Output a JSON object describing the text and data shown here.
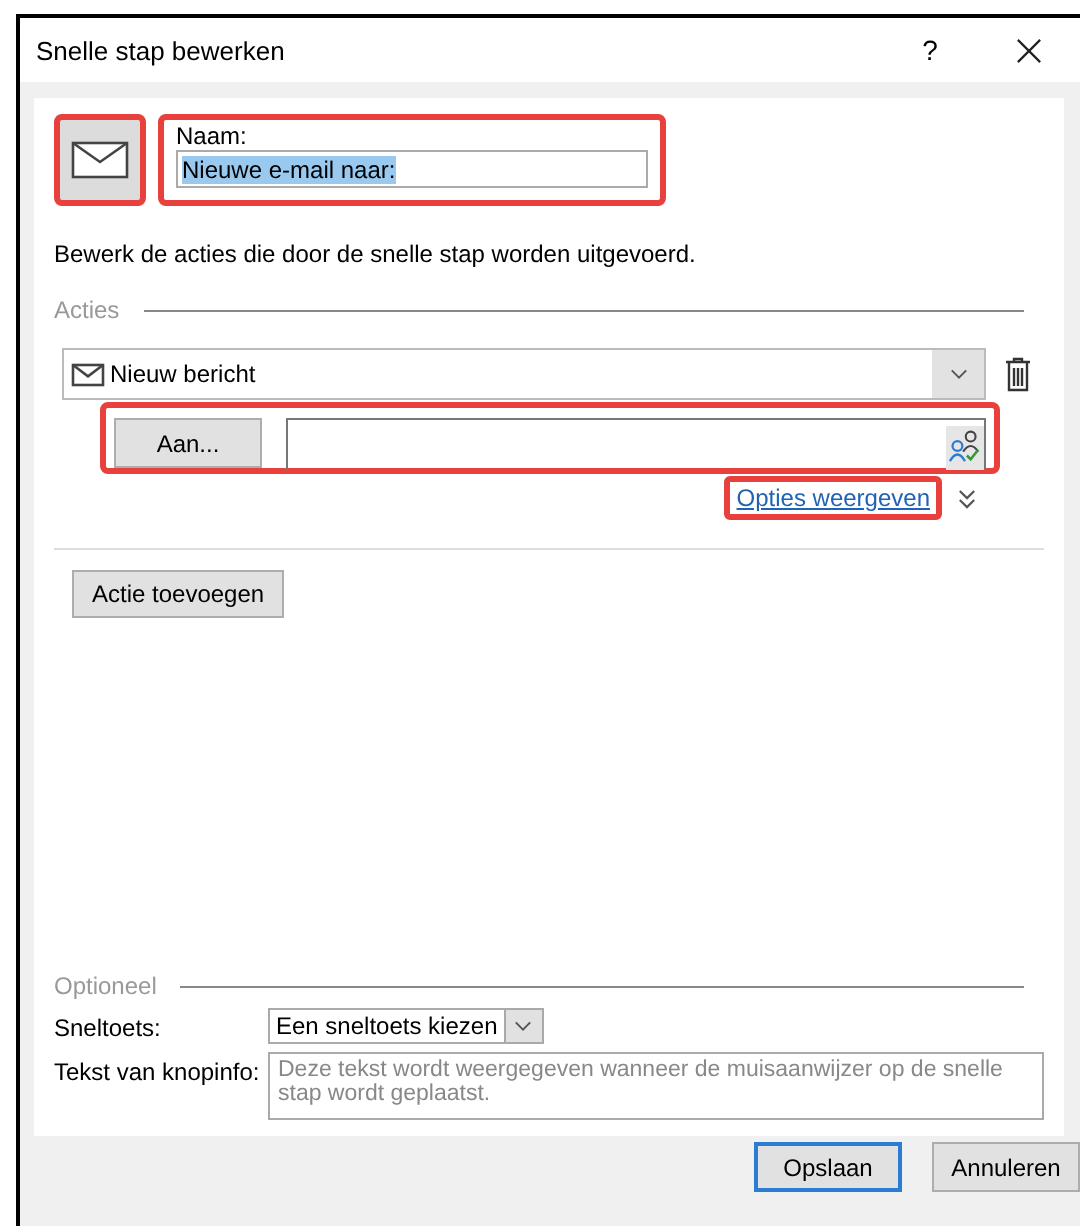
{
  "window": {
    "title": "Snelle stap bewerken",
    "help": "?"
  },
  "icon_button": {
    "highlighted": true
  },
  "name_field": {
    "label": "Naam:",
    "value": "Nieuwe e-mail naar:",
    "selected": true,
    "highlighted": true
  },
  "description": "Bewerk de acties die door de snelle stap worden uitgevoerd.",
  "actions_section": {
    "heading": "Acties",
    "actions": [
      {
        "kind": "message",
        "label": "Nieuw bericht",
        "recipient_button": "Aan...",
        "recipient_highlighted": true,
        "options_link": "Opties weergeven",
        "options_link_highlighted": true
      }
    ]
  },
  "add_action_button": "Actie toevoegen",
  "optional_section": {
    "heading": "Optioneel",
    "shortcut_label": "Sneltoets:",
    "shortcut_value": "Een sneltoets kiezen",
    "tooltip_label": "Tekst van knopinfo:",
    "tooltip_placeholder": "Deze tekst wordt weergegeven wanneer de muisaanwijzer op de snelle stap wordt geplaatst."
  },
  "buttons": [
    {
      "label": "Opslaan",
      "default": true
    },
    {
      "label": "Annuleren",
      "default": false
    }
  ]
}
